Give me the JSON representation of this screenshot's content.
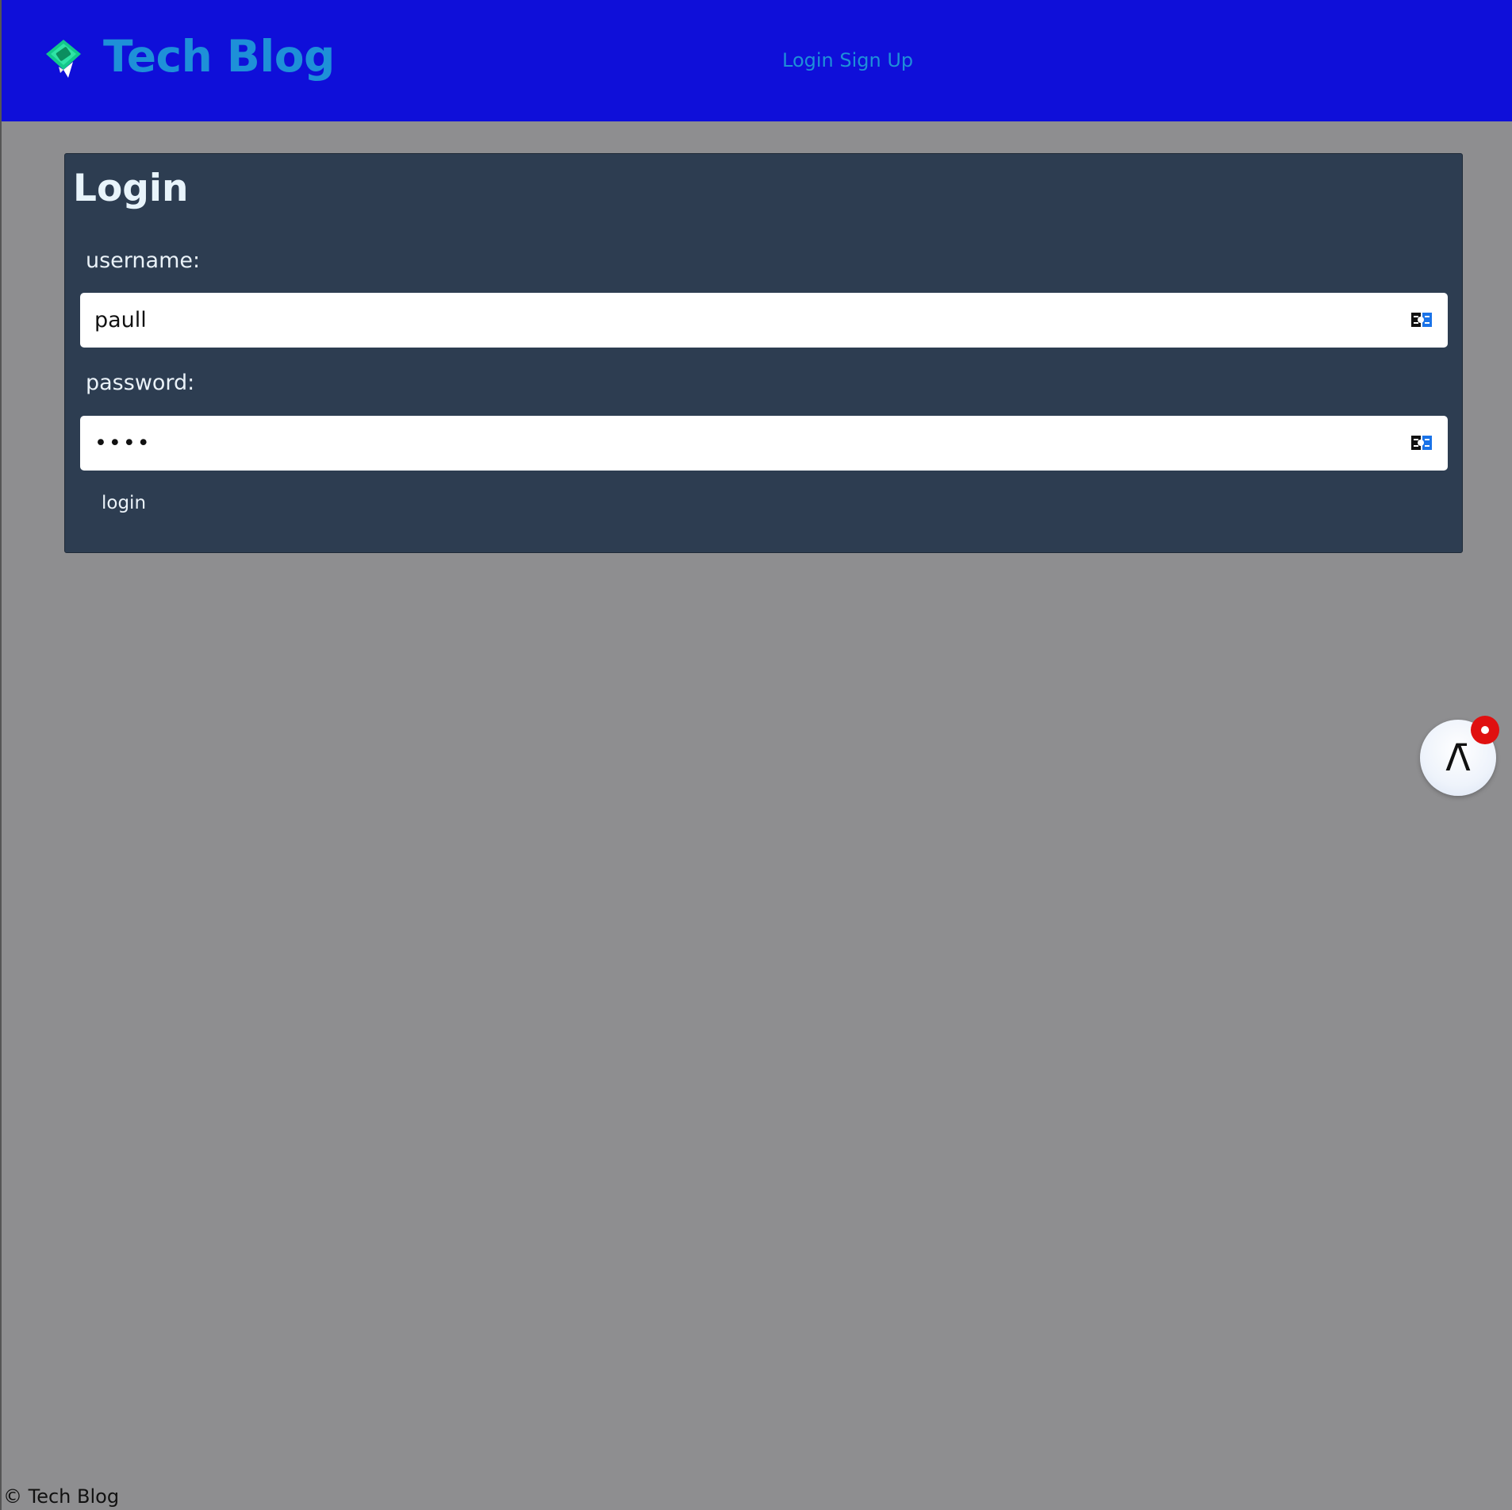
{
  "header": {
    "logo_icon": "money-card-icon",
    "title": "Tech Blog",
    "nav": {
      "login": "Login",
      "signup": "Sign Up"
    }
  },
  "login_form": {
    "title": "Login",
    "username_label": "username:",
    "username_value": "paull",
    "password_label": "password:",
    "password_value": "••••",
    "field_icon": "password-manager-icon",
    "submit_label": "login"
  },
  "floating_button": {
    "icon": "lambda-icon",
    "glyph": "Λ̄",
    "badge_icon": "notification-dot-icon"
  },
  "footer": {
    "text": "© Tech Blog"
  },
  "colors": {
    "header_bg": "#0f0fd9",
    "brand_text": "#1e90d8",
    "page_bg": "#8e8e90",
    "card_bg": "#2d3d51",
    "badge": "#e01010"
  }
}
